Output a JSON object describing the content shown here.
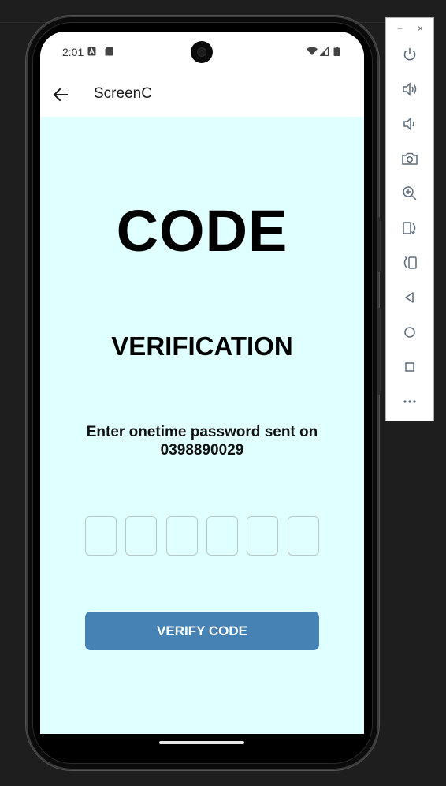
{
  "status_bar": {
    "time": "2:01"
  },
  "app_bar": {
    "title": "ScreenC",
    "back_icon": "arrow-left-icon"
  },
  "main": {
    "heading": "CODE",
    "subheading": "VERIFICATION",
    "description": "Enter onetime password sent on 0398890029",
    "otp_inputs": [
      "",
      "",
      "",
      "",
      "",
      ""
    ],
    "verify_label": "VERIFY CODE"
  },
  "colors": {
    "screen_background": "#e0ffff",
    "button": "#4682b4",
    "button_text": "#ffffff"
  },
  "emulator_panel": {
    "window_controls": [
      "−",
      "×"
    ],
    "tools": [
      "power-icon",
      "volume-up-icon",
      "volume-down-icon",
      "camera-icon",
      "zoom-in-icon",
      "rotate-left-icon",
      "rotate-right-icon",
      "back-icon",
      "home-icon",
      "overview-icon",
      "more-icon"
    ]
  }
}
